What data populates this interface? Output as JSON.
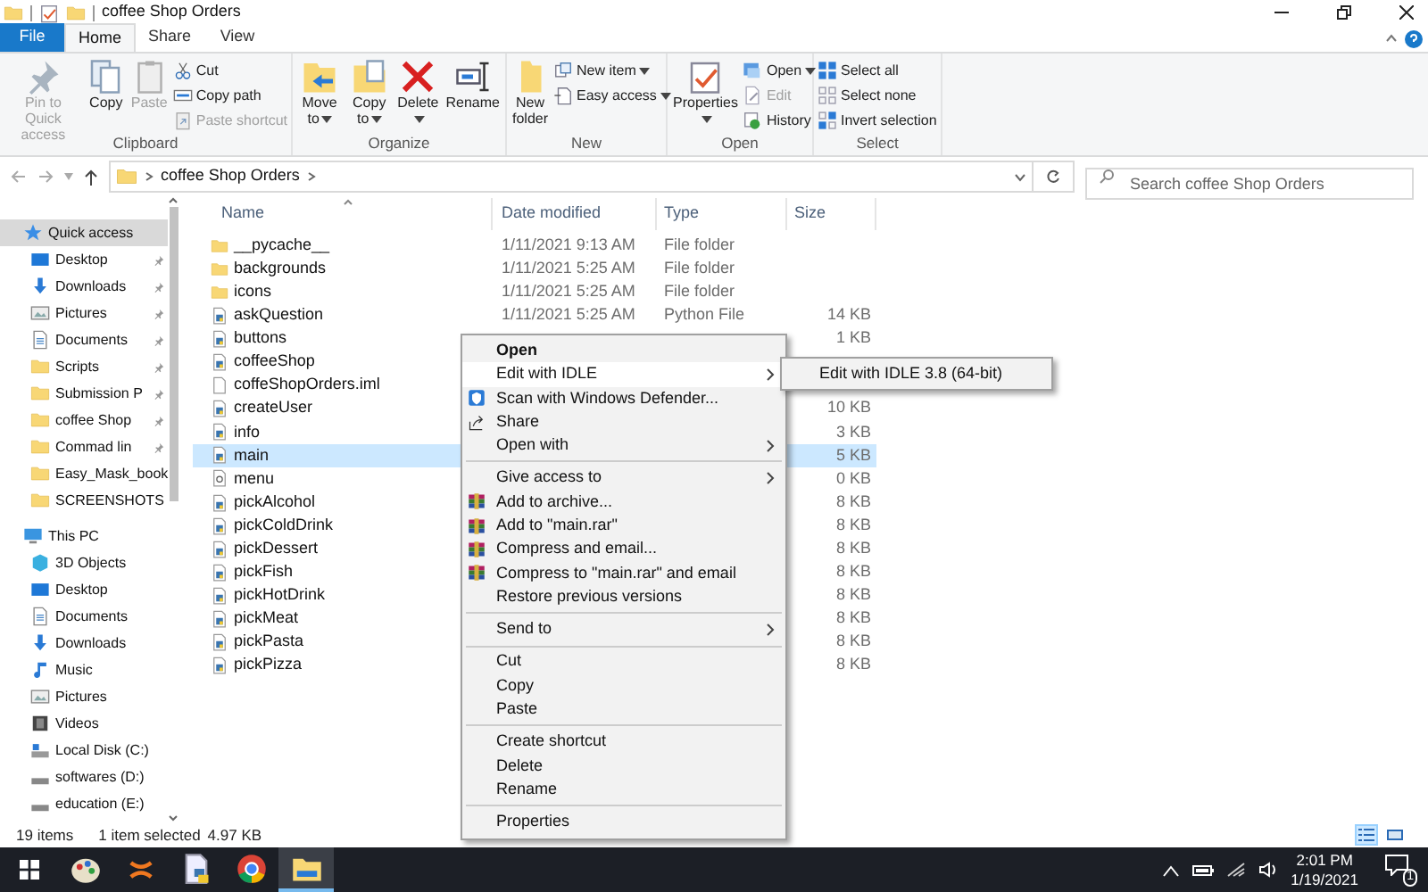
{
  "title_bar": {
    "title": "coffee Shop Orders"
  },
  "ribbon_tabs": [
    {
      "label": "File",
      "kind": "file",
      "selected": false
    },
    {
      "label": "Home",
      "kind": "tab",
      "selected": true
    },
    {
      "label": "Share",
      "kind": "tab",
      "selected": false
    },
    {
      "label": "View",
      "kind": "tab",
      "selected": false
    }
  ],
  "ribbon_groups": [
    {
      "label": "Clipboard",
      "large": [
        {
          "label": "Pin to Quick access",
          "disabled": true,
          "dropdown": false
        },
        {
          "label": "Copy",
          "disabled": false,
          "dropdown": false
        },
        {
          "label": "Paste",
          "disabled": true,
          "dropdown": false
        }
      ],
      "small": [
        {
          "label": "Cut",
          "disabled": false,
          "dropdown": false
        },
        {
          "label": "Copy path",
          "disabled": false,
          "dropdown": false
        },
        {
          "label": "Paste shortcut",
          "disabled": true,
          "dropdown": false
        }
      ]
    },
    {
      "label": "Organize",
      "large": [
        {
          "label": "Move to",
          "disabled": false,
          "dropdown": true
        },
        {
          "label": "Copy to",
          "disabled": false,
          "dropdown": true
        },
        {
          "label": "Delete",
          "disabled": false,
          "dropdown": true
        },
        {
          "label": "Rename",
          "disabled": false,
          "dropdown": false
        }
      ]
    },
    {
      "label": "New",
      "large": [
        {
          "label": "New folder",
          "disabled": false,
          "dropdown": false
        }
      ],
      "small": [
        {
          "label": "New item",
          "disabled": false,
          "dropdown": true
        },
        {
          "label": "Easy access",
          "disabled": false,
          "dropdown": true
        }
      ]
    },
    {
      "label": "Open",
      "large": [
        {
          "label": "Properties",
          "disabled": false,
          "dropdown": true
        }
      ],
      "small": [
        {
          "label": "Open",
          "disabled": false,
          "dropdown": true
        },
        {
          "label": "Edit",
          "disabled": true,
          "dropdown": false
        },
        {
          "label": "History",
          "disabled": false,
          "dropdown": false
        }
      ]
    },
    {
      "label": "Select",
      "small": [
        {
          "label": "Select all",
          "disabled": false,
          "dropdown": false
        },
        {
          "label": "Select none",
          "disabled": false,
          "dropdown": false
        },
        {
          "label": "Invert selection",
          "disabled": false,
          "dropdown": false
        }
      ]
    }
  ],
  "address_bar": {
    "path": "coffee Shop Orders",
    "search_placeholder": "Search coffee Shop Orders"
  },
  "sidebar": [
    {
      "label": "Quick access",
      "kind": "star",
      "selected": true,
      "children": [
        {
          "label": "Desktop",
          "kind": "desktop",
          "pinned": true,
          "selected": false
        },
        {
          "label": "Downloads",
          "kind": "download",
          "pinned": true,
          "selected": false
        },
        {
          "label": "Pictures",
          "kind": "pictures",
          "pinned": true,
          "selected": false
        },
        {
          "label": "Documents",
          "kind": "documents",
          "pinned": true,
          "selected": false
        },
        {
          "label": "Scripts",
          "kind": "folder",
          "pinned": true,
          "selected": false
        },
        {
          "label": "Submission P",
          "kind": "folder",
          "pinned": true,
          "selected": false
        },
        {
          "label": "coffee Shop",
          "kind": "folder",
          "pinned": true,
          "selected": false
        },
        {
          "label": "Commad lin",
          "kind": "folder",
          "pinned": true,
          "selected": false
        },
        {
          "label": "Easy_Mask_book",
          "kind": "folder",
          "pinned": false,
          "selected": false
        },
        {
          "label": "SCREENSHOTS",
          "kind": "folder",
          "pinned": false,
          "selected": false
        }
      ]
    },
    {
      "label": "This PC",
      "kind": "pc",
      "selected": false,
      "children": [
        {
          "label": "3D Objects",
          "kind": "cube",
          "pinned": false,
          "selected": false
        },
        {
          "label": "Desktop",
          "kind": "desktop",
          "pinned": false,
          "selected": false
        },
        {
          "label": "Documents",
          "kind": "documents",
          "pinned": false,
          "selected": false
        },
        {
          "label": "Downloads",
          "kind": "download",
          "pinned": false,
          "selected": false
        },
        {
          "label": "Music",
          "kind": "music",
          "pinned": false,
          "selected": false
        },
        {
          "label": "Pictures",
          "kind": "pictures",
          "pinned": false,
          "selected": false
        },
        {
          "label": "Videos",
          "kind": "video",
          "pinned": false,
          "selected": false
        },
        {
          "label": "Local Disk (C:)",
          "kind": "osdrive",
          "pinned": false,
          "selected": false
        },
        {
          "label": "softwares (D:)",
          "kind": "drive",
          "pinned": false,
          "selected": false
        },
        {
          "label": "education (E:)",
          "kind": "drive",
          "pinned": false,
          "selected": false
        }
      ]
    }
  ],
  "columns": [
    {
      "label": "Name",
      "sorted": true
    },
    {
      "label": "Date modified",
      "sorted": false
    },
    {
      "label": "Type",
      "sorted": false
    },
    {
      "label": "Size",
      "sorted": false
    }
  ],
  "files": [
    {
      "name": "__pycache__",
      "kind": "folder",
      "date": "1/11/2021 9:13 AM",
      "type": "File folder",
      "selected": false
    },
    {
      "name": "backgrounds",
      "kind": "folder",
      "date": "1/11/2021 5:25 AM",
      "type": "File folder",
      "selected": false
    },
    {
      "name": "icons",
      "kind": "folder",
      "date": "1/11/2021 5:25 AM",
      "type": "File folder",
      "selected": false
    },
    {
      "name": "askQuestion",
      "kind": "python",
      "date": "1/11/2021 5:25 AM",
      "type": "Python File",
      "size": "14 KB",
      "selected": false
    },
    {
      "name": "buttons",
      "kind": "python",
      "size": "1 KB",
      "selected": false
    },
    {
      "name": "coffeeShop",
      "kind": "python",
      "selected": false
    },
    {
      "name": "coffeShopOrders.iml",
      "kind": "file",
      "selected": false
    },
    {
      "name": "createUser",
      "kind": "python",
      "size": "10 KB",
      "selected": false
    },
    {
      "name": "info",
      "kind": "python",
      "size": "3 KB",
      "selected": false
    },
    {
      "name": "main",
      "kind": "python",
      "size": "5 KB",
      "selected": true
    },
    {
      "name": "menu",
      "kind": "script",
      "size": "0 KB",
      "selected": false
    },
    {
      "name": "pickAlcohol",
      "kind": "python",
      "size": "8 KB",
      "selected": false
    },
    {
      "name": "pickColdDrink",
      "kind": "python",
      "size": "8 KB",
      "selected": false
    },
    {
      "name": "pickDessert",
      "kind": "python",
      "size": "8 KB",
      "selected": false
    },
    {
      "name": "pickFish",
      "kind": "python",
      "size": "8 KB",
      "selected": false
    },
    {
      "name": "pickHotDrink",
      "kind": "python",
      "size": "8 KB",
      "selected": false
    },
    {
      "name": "pickMeat",
      "kind": "python",
      "size": "8 KB",
      "selected": false
    },
    {
      "name": "pickPasta",
      "kind": "python",
      "size": "8 KB",
      "selected": false
    },
    {
      "name": "pickPizza",
      "kind": "python",
      "size": "8 KB",
      "selected": false
    }
  ],
  "status_bar": {
    "count": "19 items",
    "selection": "1 item selected",
    "size": "4.97 KB"
  },
  "view_buttons": [
    {
      "kind": "details",
      "selected": true
    },
    {
      "kind": "tiles",
      "selected": false
    }
  ],
  "context_menu": [
    {
      "kind": "item",
      "label": "Open",
      "bold": true,
      "has_submenu": false,
      "selected": false
    },
    {
      "kind": "item",
      "label": "Edit with IDLE",
      "bold": false,
      "has_submenu": true,
      "selected": true
    },
    {
      "kind": "item",
      "label": "Scan with Windows Defender...",
      "bold": false,
      "has_submenu": false,
      "selected": false
    },
    {
      "kind": "item",
      "label": "Share",
      "bold": false,
      "has_submenu": false,
      "selected": false
    },
    {
      "kind": "item",
      "label": "Open with",
      "bold": false,
      "has_submenu": true,
      "selected": false
    },
    {
      "kind": "separator"
    },
    {
      "kind": "item",
      "label": "Give access to",
      "bold": false,
      "has_submenu": true,
      "selected": false
    },
    {
      "kind": "item",
      "label": "Add to archive...",
      "bold": false,
      "has_submenu": false,
      "selected": false
    },
    {
      "kind": "item",
      "label": "Add to \"main.rar\"",
      "bold": false,
      "has_submenu": false,
      "selected": false
    },
    {
      "kind": "item",
      "label": "Compress and email...",
      "bold": false,
      "has_submenu": false,
      "selected": false
    },
    {
      "kind": "item",
      "label": "Compress to \"main.rar\" and email",
      "bold": false,
      "has_submenu": false,
      "selected": false
    },
    {
      "kind": "item",
      "label": "Restore previous versions",
      "bold": false,
      "has_submenu": false,
      "selected": false
    },
    {
      "kind": "separator"
    },
    {
      "kind": "item",
      "label": "Send to",
      "bold": false,
      "has_submenu": true,
      "selected": false
    },
    {
      "kind": "separator"
    },
    {
      "kind": "item",
      "label": "Cut",
      "bold": false,
      "has_submenu": false,
      "selected": false
    },
    {
      "kind": "item",
      "label": "Copy",
      "bold": false,
      "has_submenu": false,
      "selected": false
    },
    {
      "kind": "item",
      "label": "Paste",
      "bold": false,
      "has_submenu": false,
      "selected": false
    },
    {
      "kind": "separator"
    },
    {
      "kind": "item",
      "label": "Create shortcut",
      "bold": false,
      "has_submenu": false,
      "selected": false
    },
    {
      "kind": "item",
      "label": "Delete",
      "bold": false,
      "has_submenu": false,
      "selected": false
    },
    {
      "kind": "item",
      "label": "Rename",
      "bold": false,
      "has_submenu": false,
      "selected": false
    },
    {
      "kind": "separator"
    },
    {
      "kind": "item",
      "label": "Properties",
      "bold": false,
      "has_submenu": false,
      "selected": false
    }
  ],
  "submenu": [
    {
      "label": "Edit with IDLE 3.8 (64-bit)",
      "selected": false
    }
  ],
  "taskbar": {
    "apps": [
      {
        "kind": "palette",
        "active": false
      },
      {
        "kind": "arcs",
        "active": false
      },
      {
        "kind": "python",
        "active": false
      },
      {
        "kind": "browser",
        "active": false
      },
      {
        "kind": "explorer",
        "active": true
      }
    ],
    "time": "2:01 PM",
    "date": "1/19/2021",
    "notifications": "1"
  }
}
